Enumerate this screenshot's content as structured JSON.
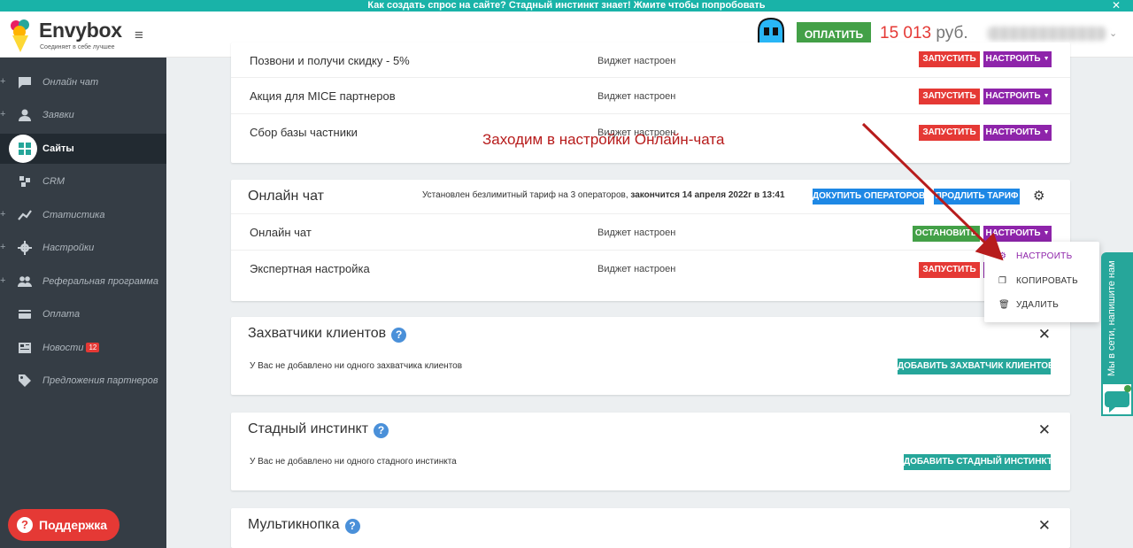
{
  "promo_bar": {
    "text": "Как создать спрос на сайте? Стадный инстинкт знает! Жмите чтобы попробовать",
    "close": "✕"
  },
  "header": {
    "logo": "Envybox",
    "logo_sub": "Соединяет в себе лучшее",
    "pay_label": "ОПЛАТИТЬ",
    "balance_amount": "15 013",
    "balance_currency": "руб."
  },
  "sidebar": {
    "items": [
      {
        "label": "Онлайн чат",
        "icon": "chat-icon"
      },
      {
        "label": "Заявки",
        "icon": "person-icon"
      },
      {
        "label": "Сайты",
        "icon": "sites-icon",
        "active": true
      },
      {
        "label": "CRM",
        "icon": "crm-icon"
      },
      {
        "label": "Статистика",
        "icon": "chart-icon"
      },
      {
        "label": "Настройки",
        "icon": "gear-icon"
      },
      {
        "label": "Реферальная программа",
        "icon": "group-icon"
      },
      {
        "label": "Оплата",
        "icon": "card-icon"
      },
      {
        "label": "Новости",
        "icon": "news-icon",
        "badge": "12"
      },
      {
        "label": "Предложения партнеров",
        "icon": "tag-icon"
      }
    ],
    "support_label": "Поддержка"
  },
  "widgets_card": {
    "rows": [
      {
        "name": "Позвони и получи скидку - 5%",
        "status": "Виджет настроен",
        "run": "ЗАПУСТИТЬ",
        "config": "НАСТРОИТЬ"
      },
      {
        "name": "Акция для MICE партнеров",
        "status": "Виджет настроен",
        "run": "ЗАПУСТИТЬ",
        "config": "НАСТРОИТЬ"
      },
      {
        "name": "Сбор базы частники",
        "status": "Виджет настроен",
        "run": "ЗАПУСТИТЬ",
        "config": "НАСТРОИТЬ"
      }
    ]
  },
  "online_chat_card": {
    "title": "Онлайн чат",
    "info_prefix": "Установлен безлимитный тариф на 3 операторов,",
    "info_bold": "закончится 14 апреля 2022г в 13:41",
    "buy_operators": "ДОКУПИТЬ ОПЕРАТОРОВ",
    "extend_tariff": "ПРОДЛИТЬ ТАРИФ",
    "rows": [
      {
        "name": "Онлайн чат",
        "status": "Виджет настроен",
        "stop": "ОСТАНОВИТЬ",
        "config": "НАСТРОИТЬ"
      },
      {
        "name": "Экспертная настройка",
        "status": "Виджет настроен",
        "run": "ЗАПУСТИТЬ"
      }
    ]
  },
  "dropdown": {
    "items": [
      {
        "label": "НАСТРОИТЬ",
        "icon": "gear-icon"
      },
      {
        "label": "КОПИРОВАТЬ",
        "icon": "copy-icon"
      },
      {
        "label": "УДАЛИТЬ",
        "icon": "trash-icon"
      }
    ]
  },
  "catchers_card": {
    "title": "Захватчики клиентов",
    "empty_text": "У Вас не добавлено ни одного захватчика клиентов",
    "add_label": "ДОБАВИТЬ ЗАХВАТЧИК КЛИЕНТОВ"
  },
  "herd_card": {
    "title": "Стадный инстинкт",
    "empty_text": "У Вас не добавлено ни одного стадного инстинкта",
    "add_label": "ДОБАВИТЬ СТАДНЫЙ ИНСТИНКТ"
  },
  "multibutton_card": {
    "title": "Мультикнопка"
  },
  "annotation": {
    "text": "Заходим в настройки Онлайн-чата"
  },
  "chat_widget": {
    "label": "Мы в сети, напишите нам"
  },
  "colors": {
    "accent": "#19b3a8",
    "red": "#e53935",
    "purple": "#8e24aa",
    "green": "#43a047",
    "blue": "#1e88e5",
    "sidebar": "#353d45"
  }
}
